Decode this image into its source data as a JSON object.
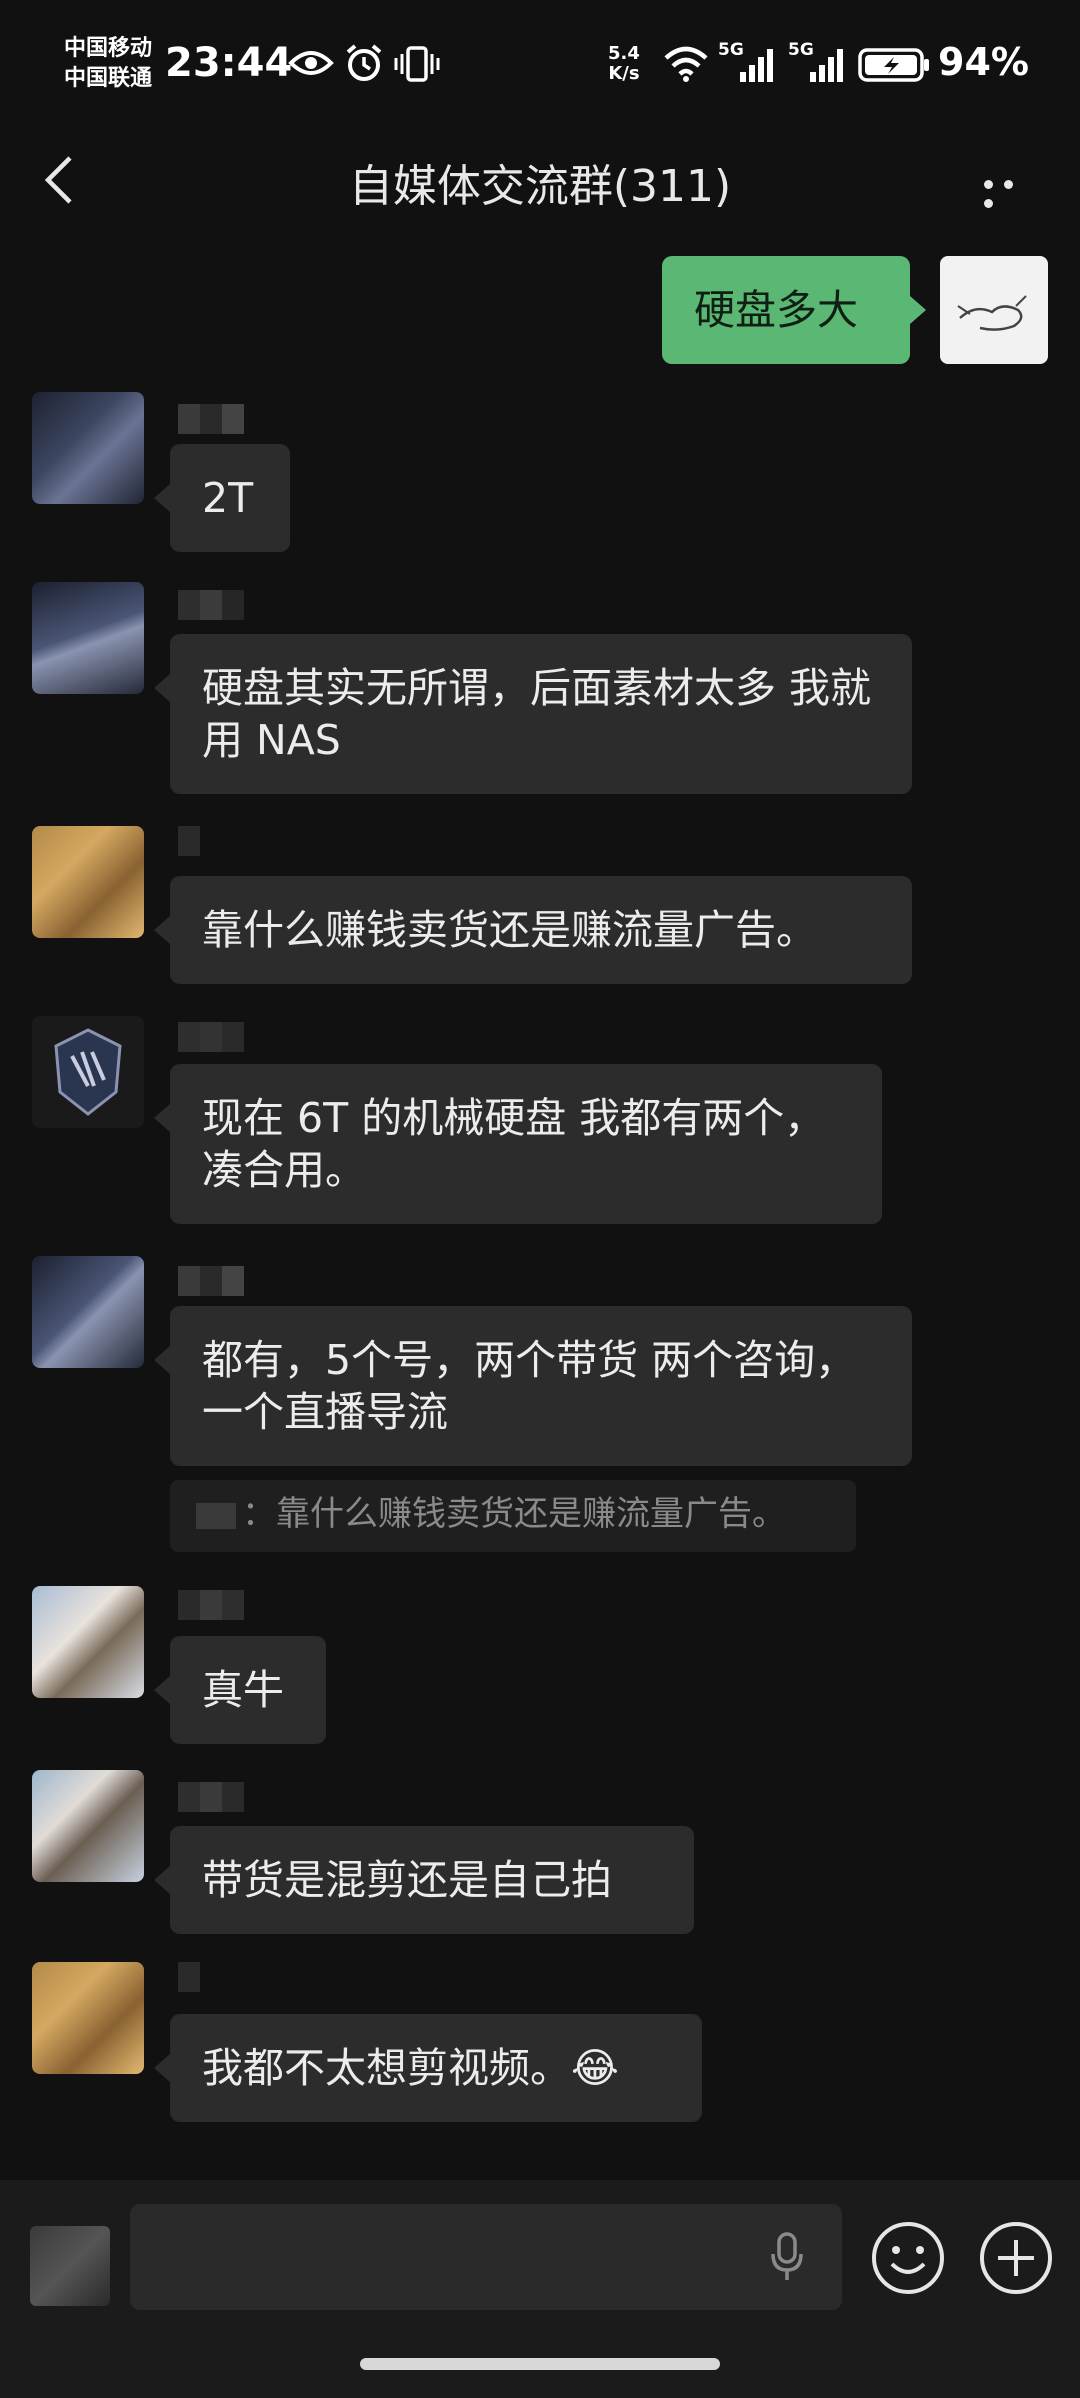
{
  "status": {
    "carrier_1": "中国移动",
    "carrier_2": "中国联通",
    "time": "23:44",
    "speed_value": "5.4",
    "speed_unit": "K/s",
    "net_1": "5G",
    "net_2": "5G",
    "battery_percent": "94%"
  },
  "header": {
    "title": "自媒体交流群(311)",
    "back_icon": "chevron-left-icon",
    "more_icon": "more-dots-icon"
  },
  "messages": [
    {
      "side": "mine",
      "text": "硬盘多大"
    },
    {
      "side": "other",
      "text": "2T"
    },
    {
      "side": "other",
      "text": "硬盘其实无所谓，后面素材太多 我就用 NAS"
    },
    {
      "side": "other",
      "text": "靠什么赚钱卖货还是赚流量广告。"
    },
    {
      "side": "other",
      "text": "现在 6T 的机械硬盘 我都有两个，凑合用。"
    },
    {
      "side": "other",
      "text": "都有，5个号，两个带货 两个咨询，一个直播导流",
      "quote": "：靠什么赚钱卖货还是赚流量广告。"
    },
    {
      "side": "other",
      "text": "真牛"
    },
    {
      "side": "other",
      "text": "带货是混剪还是自己拍"
    },
    {
      "side": "other",
      "text": "我都不太想剪视频。😂"
    }
  ],
  "composer": {
    "placeholder": "",
    "voice_icon": "microphone-icon",
    "emoji_icon": "smiley-icon",
    "plus_icon": "plus-icon"
  },
  "colors": {
    "background": "#111111",
    "bubble_other": "#2c2c2c",
    "bubble_mine": "#5ab774"
  }
}
